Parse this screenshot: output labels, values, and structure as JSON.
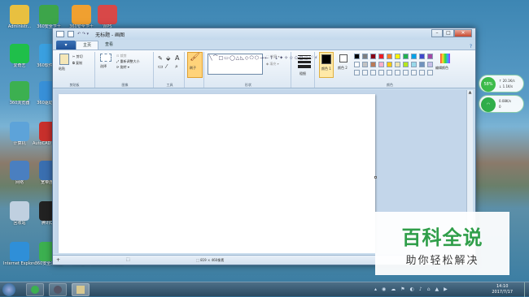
{
  "desktop_icons": [
    {
      "label": "Administr...",
      "color": "#e8c040"
    },
    {
      "label": "360安全卫士",
      "color": "#3da54a"
    },
    {
      "label": "360安全卫士",
      "color": "#f0a030"
    },
    {
      "label": "WPS",
      "color": "#d84848"
    },
    {
      "label": "爱奇艺",
      "color": "#1fbf4a"
    },
    {
      "label": "360软件管家",
      "color": "#3aa0e0"
    },
    {
      "label": "360浏览器",
      "color": "#3cb050"
    },
    {
      "label": "360驱动大师",
      "color": "#3890d8"
    },
    {
      "label": "计算机",
      "color": "#5da3d9"
    },
    {
      "label": "AutoCAD 2015 - 简体",
      "color": "#c8302c"
    },
    {
      "label": "网络",
      "color": "#4a7fc0"
    },
    {
      "label": "宽带连接",
      "color": "#3a6fb0"
    },
    {
      "label": "回收站",
      "color": "#c0d0e0"
    },
    {
      "label": "腾讯QQ",
      "color": "#222222"
    },
    {
      "label": "Internet Explorer",
      "color": "#2f8fd8"
    },
    {
      "label": "360安全浏览器",
      "color": "#3cb050"
    },
    {
      "label": "Notepad",
      "color": "#cccccc"
    },
    {
      "label": "SolidWorks 2016",
      "color": "#c03030"
    }
  ],
  "paint": {
    "title": "无标题 - 画图",
    "file_tab": "▾",
    "tabs": [
      "主页",
      "查看"
    ],
    "clipboard": {
      "paste": "粘贴",
      "cut": "剪切",
      "copy": "复制",
      "label": "剪贴板"
    },
    "image": {
      "select": "选择",
      "crop": "裁剪",
      "resize": "重新调整大小",
      "rotate": "旋转",
      "label": "图像"
    },
    "tools": {
      "label": "工具"
    },
    "brushes": {
      "label": "刷子"
    },
    "shapes": {
      "outline": "轮廓",
      "fill": "填充",
      "label": "形状"
    },
    "size": {
      "label": "粗细"
    },
    "colors": {
      "color1": "颜色 1",
      "color2": "颜色 2",
      "edit": "编辑颜色",
      "label": "颜色",
      "palette": [
        "#000000",
        "#7f7f7f",
        "#880015",
        "#ed1c24",
        "#ff7f27",
        "#fff200",
        "#22b14c",
        "#00a2e8",
        "#3f48cc",
        "#a349a4",
        "#ffffff",
        "#c3c3c3",
        "#b97a57",
        "#ffaec9",
        "#ffc90e",
        "#efe4b0",
        "#b5e61d",
        "#99d9ea",
        "#7092be",
        "#c8bfe7"
      ]
    },
    "status": {
      "dimensions": "819 × 460像素"
    }
  },
  "gadgets": {
    "net1": {
      "percent": "58%",
      "up": "20.1K/s",
      "down": "1.1K/s"
    },
    "net2": {
      "speed": "0.08K/s",
      "count": "0"
    }
  },
  "watermark": {
    "title": "百科全说",
    "subtitle": "助你轻松解决"
  },
  "taskbar": {
    "time": "14:10",
    "date": "2017/7/17"
  }
}
